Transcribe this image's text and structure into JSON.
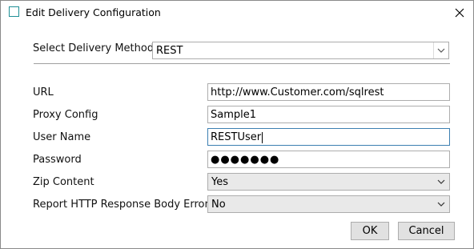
{
  "window": {
    "title": "Edit Delivery Configuration"
  },
  "delivery": {
    "label": "Select Delivery Method",
    "value": "REST"
  },
  "fields": {
    "url": {
      "label": "URL",
      "value": "http://www.Customer.com/sqlrest"
    },
    "proxy": {
      "label": "Proxy Config",
      "value": "Sample1"
    },
    "user": {
      "label": "User Name",
      "value": "RESTUser"
    },
    "password": {
      "label": "Password",
      "value": "●●●●●●●"
    },
    "zip": {
      "label": "Zip Content",
      "value": "Yes"
    },
    "report_error": {
      "label": "Report HTTP Response Body Error",
      "value": "No"
    }
  },
  "buttons": {
    "ok": "OK",
    "cancel": "Cancel"
  },
  "icons": {
    "app": "window-app-icon",
    "close": "close-icon",
    "dropdown": "chevron-down-icon"
  },
  "colors": {
    "app_icon": "#1f8f96",
    "focus_border": "#3c7fb1",
    "button_bg": "#e1e1e1",
    "combo_bg": "#e9e9e9"
  }
}
